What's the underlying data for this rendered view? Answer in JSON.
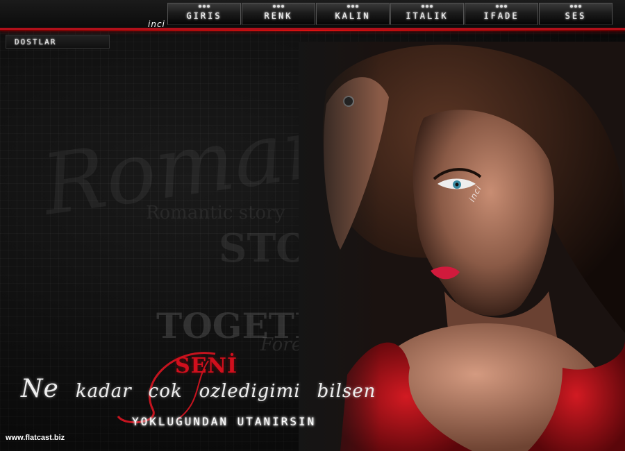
{
  "nav": {
    "tag": "inci",
    "items": [
      {
        "label": "GIRIS"
      },
      {
        "label": "RENK"
      },
      {
        "label": "KALIN"
      },
      {
        "label": "ITALIK"
      },
      {
        "label": "IFADE"
      },
      {
        "label": "SES"
      }
    ]
  },
  "sidebar": {
    "button_label": "DOSTLAR"
  },
  "background_text": {
    "romance": "Romance",
    "story_small": "Romantic story",
    "story_big": "STO",
    "together": "TOGETHE",
    "forever": "Foreve"
  },
  "portrait": {
    "signature": "inci"
  },
  "lyrics": {
    "title": "SENİ",
    "line1_words": [
      "Ne",
      "kadar",
      "cok",
      "ozledigimi",
      "bilsen"
    ],
    "line2": "YOKLUGUNDAN UTANIRSIN"
  },
  "footer": {
    "watermark": "www.flatcast.biz"
  },
  "colors": {
    "accent": "#b0101a",
    "dress": "#c3141c",
    "lips": "#d11a3c"
  }
}
